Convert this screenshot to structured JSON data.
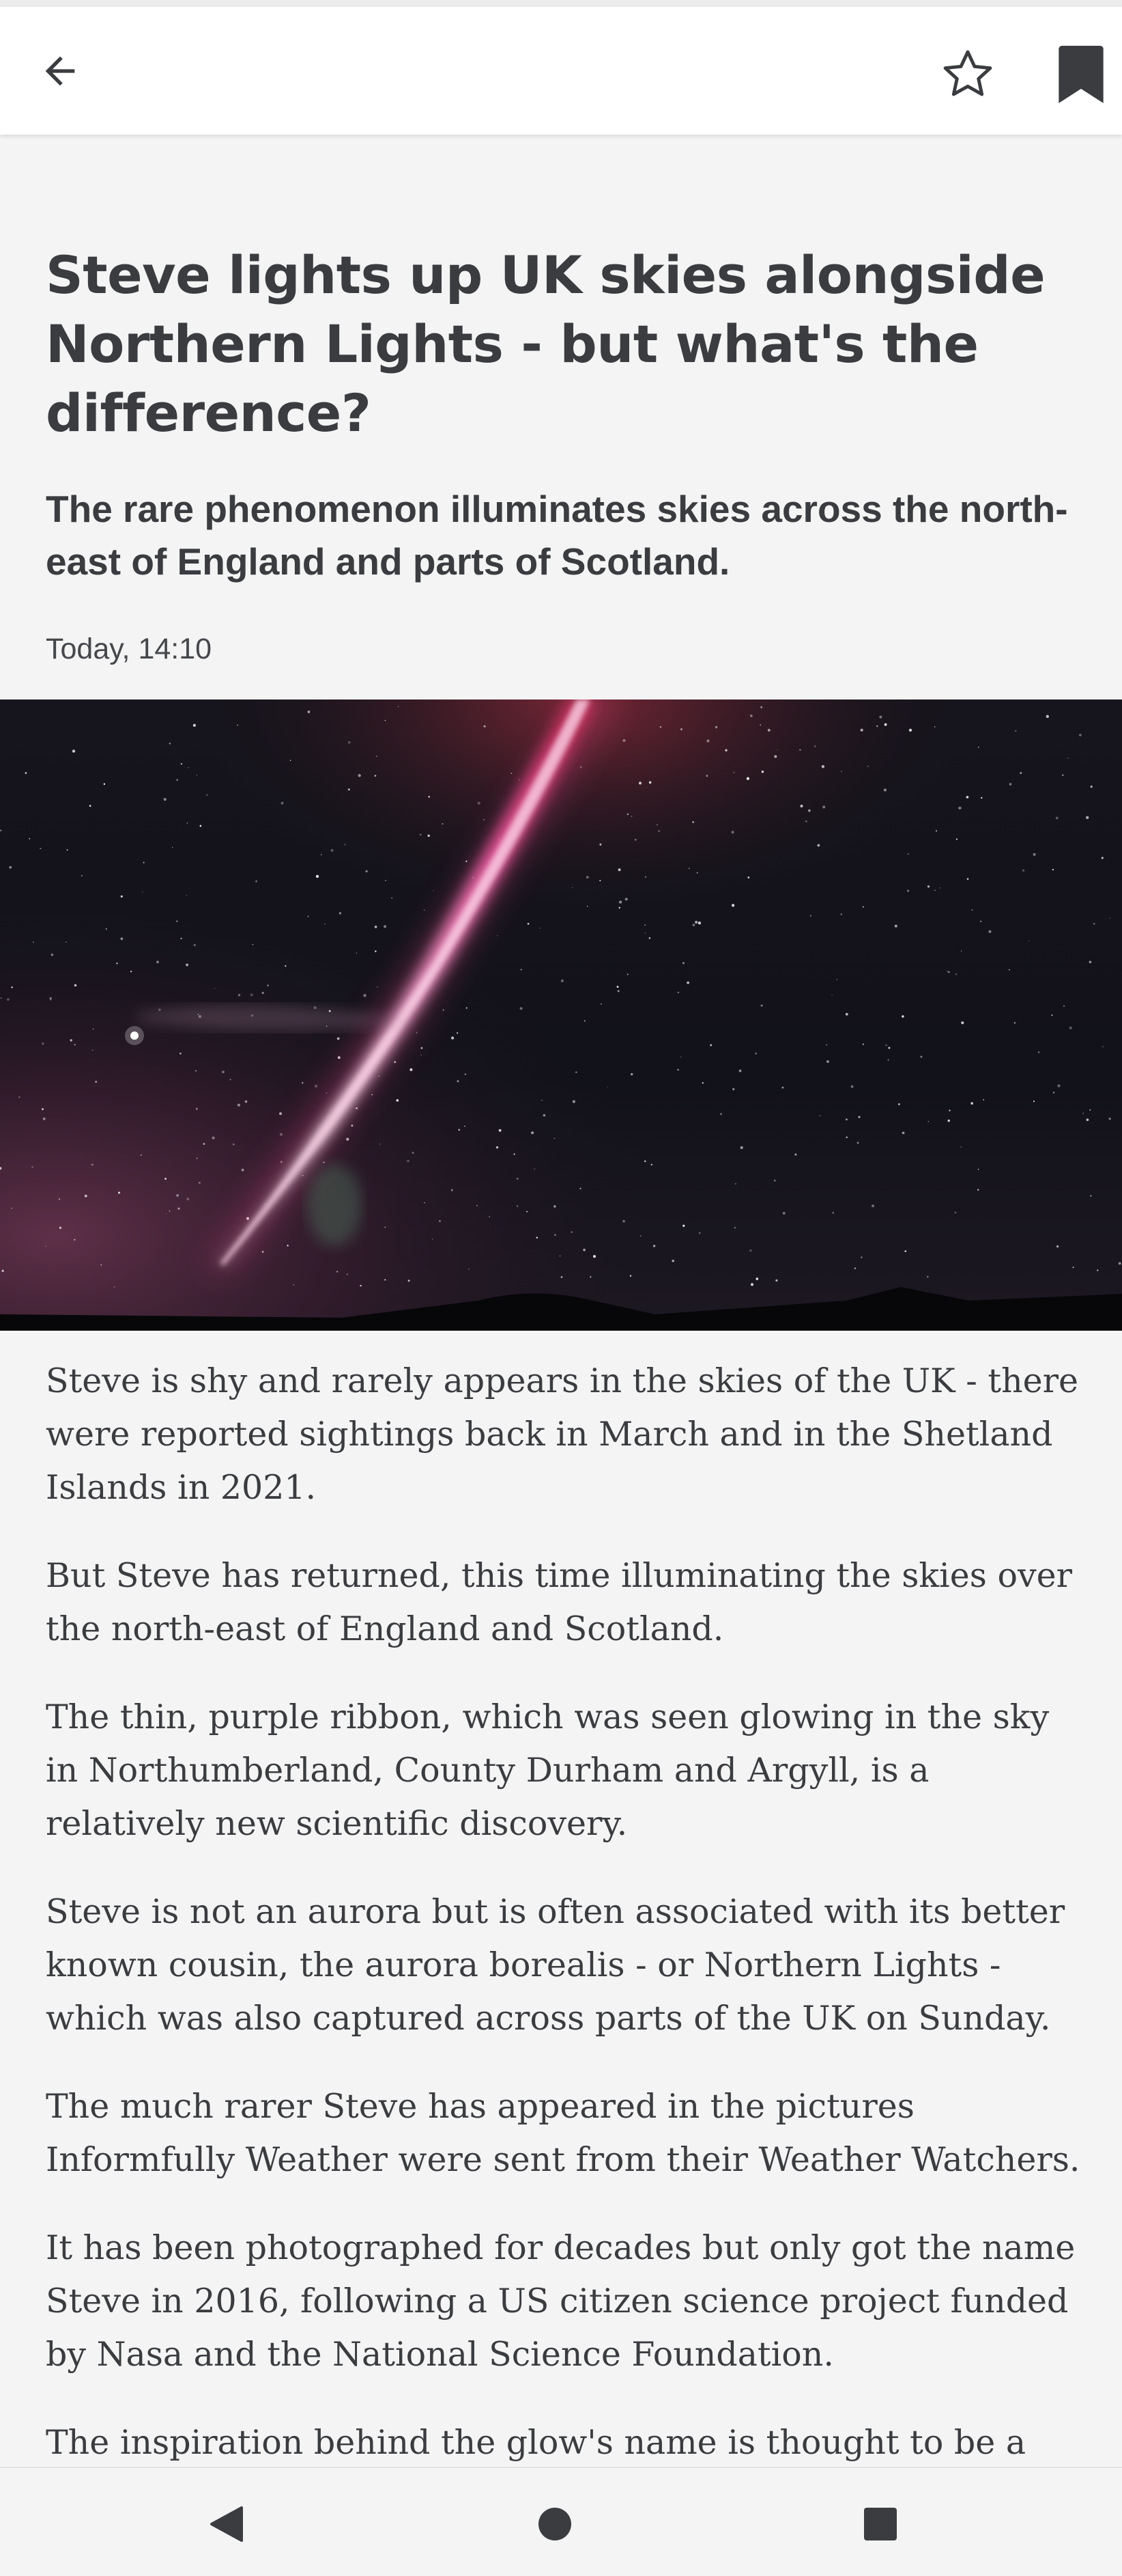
{
  "header": {
    "back_icon": "arrow-left-icon",
    "favourite_icon": "star-outline-icon",
    "bookmark_icon": "bookmark-filled-icon"
  },
  "article": {
    "headline": "Steve lights up UK skies alongside Northern Lights - but what's the difference?",
    "standfirst": "The rare phenomenon illuminates skies across the north-east of England and parts of Scotland.",
    "timestamp": "Today, 14:10",
    "image": "Purple-pink Steve ribbon arcing across a starry night sky",
    "paragraphs": [
      "Steve is shy and rarely appears in the skies of the UK - there were reported sightings back in March and in the Shetland Islands in 2021.",
      "But Steve has returned, this time illuminating the skies over the north-east of England and Scotland.",
      "The thin, purple ribbon, which was seen glowing in the sky in Northumberland, County Durham and Argyll, is a relatively new scientific discovery.",
      "Steve is not an aurora but is often associated with its better known cousin, the aurora borealis - or Northern Lights - which was also captured across parts of the UK on Sunday.",
      "The much rarer Steve has appeared in the pictures Informfully Weather were sent from their Weather Watchers.",
      "It has been photographed for decades but only got the name Steve in 2016, following a US citizen science project funded by Nasa and the National Science Foundation.",
      "The inspiration behind the glow's name is thought to be a"
    ]
  },
  "navbar": {
    "back_icon": "triangle-back-icon",
    "home_icon": "circle-home-icon",
    "recents_icon": "square-recents-icon"
  },
  "colors": {
    "text": "#3a3c40",
    "background": "#f4f4f4",
    "topbar": "#ffffff"
  }
}
